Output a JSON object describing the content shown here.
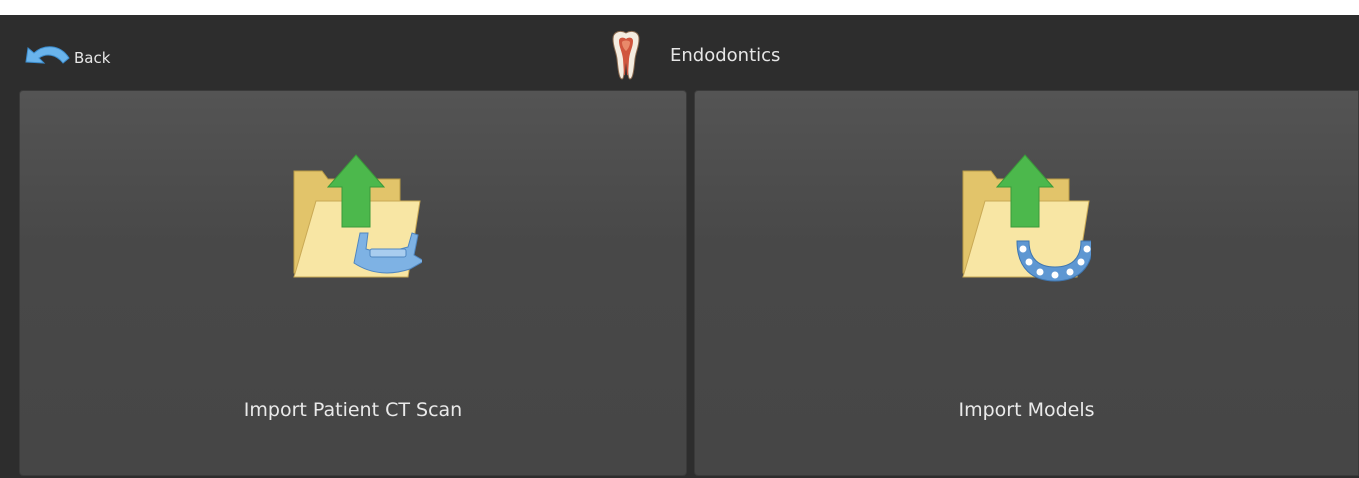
{
  "header": {
    "back_label": "Back",
    "back_icon": "back-arrow-icon",
    "title": "Endodontics",
    "title_icon": "tooth-icon"
  },
  "cards": [
    {
      "label": "Import Patient CT Scan",
      "icon": "import-ct-scan-icon"
    },
    {
      "label": "Import Models",
      "icon": "import-models-icon"
    }
  ],
  "colors": {
    "background": "#2d2d2d",
    "card": "#4b4b4b",
    "arrow_green": "#4cb84c",
    "folder": "#f3dc8f",
    "accent_blue": "#6aa3d8"
  }
}
